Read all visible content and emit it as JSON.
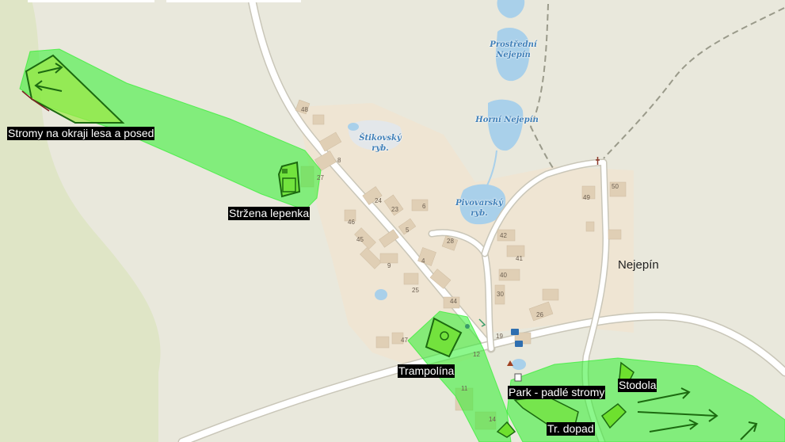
{
  "map": {
    "town_name": "Nejepín",
    "ponds": [
      {
        "name": "Prostřední Nejepín"
      },
      {
        "name": "Horní Nejepín"
      },
      {
        "name": "Štikovský",
        "name2": "ryb."
      },
      {
        "name": "Pivovarský",
        "name2": "ryb."
      }
    ],
    "annotations": [
      {
        "label": "Stromy na okraji lesa a posed"
      },
      {
        "label": "Stržena lepenka"
      },
      {
        "label": "Trampolína"
      },
      {
        "label": "Park - padlé stromy"
      },
      {
        "label": "Stodola"
      },
      {
        "label": "Tr. dopad"
      }
    ],
    "house_numbers": [
      "48",
      "8",
      "27",
      "24",
      "23",
      "6",
      "46",
      "5",
      "28",
      "45",
      "9",
      "4",
      "25",
      "44",
      "47",
      "12",
      "11",
      "14",
      "49",
      "50",
      "42",
      "41",
      "40",
      "30",
      "26",
      "19"
    ],
    "colors": {
      "land": "#e9e8dc",
      "forest": "#dde3c4",
      "village": "#efe6d6",
      "building": "#e0d0b8",
      "water": "#a9d0ea",
      "road": "#ffffff",
      "overlay_fill": "#2ef02e",
      "overlay_stroke": "#1c6a10"
    }
  }
}
